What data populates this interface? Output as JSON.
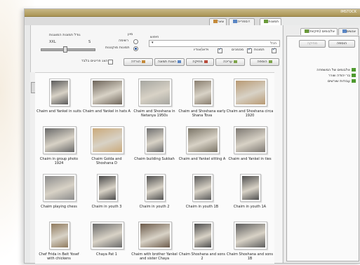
{
  "window": {
    "title": "IMSTOCK"
  },
  "tabs": [
    {
      "label": "תמונות",
      "active": true
    },
    {
      "label": "ספרייה",
      "active": false
    },
    {
      "label": "צאר",
      "active": false
    }
  ],
  "filters": {
    "search_label": "חיפוש",
    "search_value": "הכל",
    "checkboxes": [
      {
        "label": "תמונות",
        "checked": true
      },
      {
        "label": "מסמכים",
        "checked": true
      },
      {
        "label": "וידאו/אודיו",
        "checked": true
      }
    ],
    "sort_label": "מיון",
    "radio_options": [
      {
        "label": "תמונות מוקטנות",
        "selected": true
      },
      {
        "label": "רשימה",
        "selected": false
      }
    ],
    "size_label": "גודל תמונות המוצגות",
    "size_min": "S",
    "size_max": "XXL",
    "size_level": 0.55
  },
  "toolbar": {
    "buttons": [
      "הוספה",
      "עריכה",
      "מחיקה",
      "הצגת תמונה",
      "הורדה"
    ],
    "filter_check_label": "הצג פריטים בלבד"
  },
  "grid": {
    "items": [
      {
        "caption": "Chaim and Shoshana circa 1920",
        "tone": "#b89a74"
      },
      {
        "caption": "Chaim and Shoshana early Shana Tova",
        "tone": "#8a7f70"
      },
      {
        "caption": "Chaim and Shoshana in Netanya 1950s",
        "tone": "#a6a6a0"
      },
      {
        "caption": "Chaim and Yankel in hats A",
        "tone": "#6e655a"
      },
      {
        "caption": "Chaim and Yankel in suits",
        "tone": "#5b5b5b"
      },
      {
        "caption": "Chaim and Yankel in ties",
        "tone": "#7d7872"
      },
      {
        "caption": "Chaim and Yankel sitting A",
        "tone": "#7a7466"
      },
      {
        "caption": "Chaim building Sukkah",
        "tone": "#6f6f6f"
      },
      {
        "caption": "Chaim Golda and Shoshana D",
        "tone": "#caa97a"
      },
      {
        "caption": "Chaim in group photo 1924",
        "tone": "#696969"
      },
      {
        "caption": "Chaim in youth 1A",
        "tone": "#4f4f4f"
      },
      {
        "caption": "Chaim in youth 1B",
        "tone": "#5a5a5a"
      },
      {
        "caption": "Chaim in youth 2",
        "tone": "#505050"
      },
      {
        "caption": "Chaim in youth 3",
        "tone": "#4a4a4a"
      },
      {
        "caption": "Chaim playing chess",
        "tone": "#8c8c8c"
      },
      {
        "caption": "Chaim Shoshana and sons 1B",
        "tone": "#5e5e5e"
      },
      {
        "caption": "Chaim Shoshana and sons 2",
        "tone": "#4d4d4d"
      },
      {
        "caption": "Chaim with brother Yankel and sister Chaya",
        "tone": "#6b5a4a"
      },
      {
        "caption": "Chaya Pat 1",
        "tone": "#6a6a6a"
      },
      {
        "caption": "Chef Frida in Beit Yosef with chickens",
        "tone": "#8f7a5e"
      }
    ]
  },
  "sidebar": {
    "tabs": [
      "אלבומים (תיקיות)",
      "אנשים"
    ],
    "buttons": [
      "הוספה",
      "מחיקה"
    ],
    "tree": [
      "אלבומים של המשפחה",
      "בר יהודה שורר",
      "עבודות שורשים"
    ]
  }
}
